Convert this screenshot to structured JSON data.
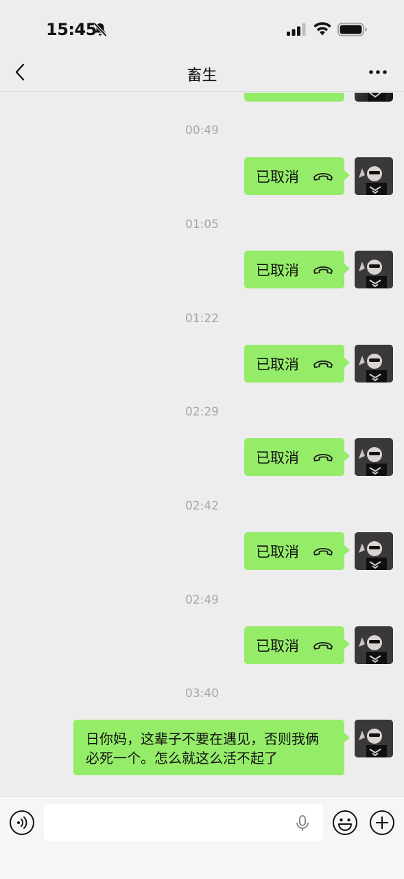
{
  "status_bar": {
    "time": "15:45",
    "icons": [
      "bell-slash-icon",
      "signal-icon",
      "wifi-icon",
      "battery-icon"
    ]
  },
  "nav": {
    "title": "畜生",
    "back_icon": "chevron-left-icon",
    "more_icon": "ellipsis-icon"
  },
  "messages": [
    {
      "timestamp": "00:49",
      "type": "call",
      "text": "已取消",
      "icon": "hangup-phone-icon"
    },
    {
      "timestamp": "01:05",
      "type": "call",
      "text": "已取消",
      "icon": "hangup-phone-icon"
    },
    {
      "timestamp": "01:22",
      "type": "call",
      "text": "已取消",
      "icon": "hangup-phone-icon"
    },
    {
      "timestamp": "02:29",
      "type": "call",
      "text": "已取消",
      "icon": "hangup-phone-icon"
    },
    {
      "timestamp": "02:42",
      "type": "call",
      "text": "已取消",
      "icon": "hangup-phone-icon"
    },
    {
      "timestamp": "02:49",
      "type": "call",
      "text": "已取消",
      "icon": "hangup-phone-icon"
    },
    {
      "timestamp": "03:40",
      "type": "text",
      "text": "日你妈，这辈子不要在遇见，否则我俩必死一个。怎么就这么活不起了"
    }
  ],
  "input_bar": {
    "placeholder": "",
    "icons": [
      "voice-icon",
      "microphone-icon",
      "emoji-icon",
      "plus-icon"
    ]
  },
  "colors": {
    "background": "#ededed",
    "bubble_green": "#95ec69",
    "timestamp_gray": "#a6a6a6"
  }
}
